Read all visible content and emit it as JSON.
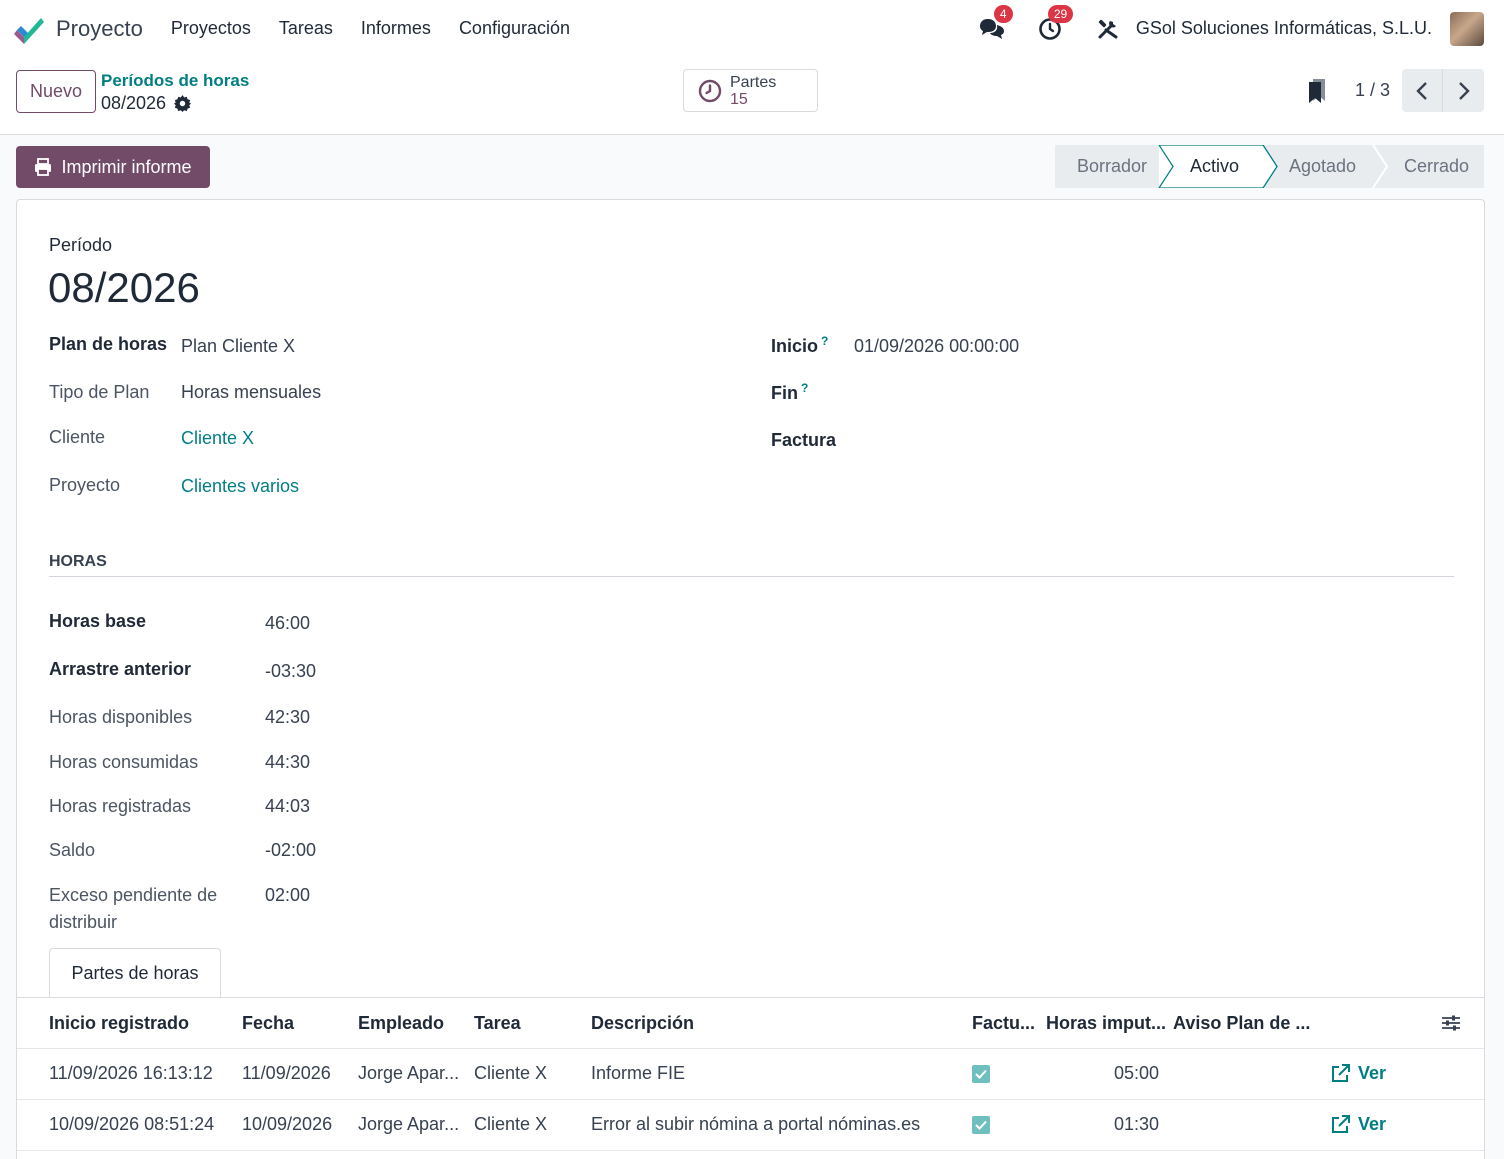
{
  "navbar": {
    "app_name": "Proyecto",
    "menu": [
      "Proyectos",
      "Tareas",
      "Informes",
      "Configuración"
    ],
    "messages_count": "4",
    "activities_count": "29",
    "company": "GSol Soluciones Informáticas, S.L.U."
  },
  "control": {
    "new_label": "Nuevo",
    "breadcrumb_parent": "Períodos de horas",
    "breadcrumb_current": "08/2026",
    "smart_label": "Partes",
    "smart_value": "15",
    "pager_value": "1 / 3"
  },
  "actions": {
    "print_label": "Imprimir informe",
    "stages": [
      "Borrador",
      "Activo",
      "Agotado",
      "Cerrado"
    ],
    "active_stage": "Activo"
  },
  "form": {
    "periodo_label": "Período",
    "title": "08/2026",
    "plan_label": "Plan de horas",
    "plan_value": "Plan Cliente X",
    "tipo_label": "Tipo de Plan",
    "tipo_value": "Horas mensuales",
    "cliente_label": "Cliente",
    "cliente_value": "Cliente X",
    "proyecto_label": "Proyecto",
    "proyecto_value": "Clientes varios",
    "inicio_label": "Inicio",
    "inicio_value": "01/09/2026 00:00:00",
    "fin_label": "Fin",
    "factura_label": "Factura",
    "help_mark": "?"
  },
  "horas": {
    "section_title": "HORAS",
    "base_label": "Horas base",
    "base_value": "46:00",
    "arrastre_label": "Arrastre anterior",
    "arrastre_value": "-03:30",
    "disponibles_label": "Horas disponibles",
    "disponibles_value": "42:30",
    "consumidas_label": "Horas consumidas",
    "consumidas_value": "44:30",
    "registradas_label": "Horas registradas",
    "registradas_value": "44:03",
    "saldo_label": "Saldo",
    "saldo_value": "-02:00",
    "exceso_label_1": "Exceso pendiente de",
    "exceso_label_2": "distribuir",
    "exceso_value": "02:00"
  },
  "tab": {
    "label": "Partes de horas"
  },
  "table": {
    "headers": [
      "Inicio registrado",
      "Fecha",
      "Empleado",
      "Tarea",
      "Descripción",
      "Factu...",
      "Horas imput...",
      "Aviso Plan de ..."
    ],
    "rows": [
      {
        "inicio": "11/09/2026 16:13:12",
        "fecha": "11/09/2026",
        "empleado": "Jorge Apar...",
        "tarea": "Cliente X",
        "descripcion": "Informe FIE",
        "facturable": true,
        "horas": "05:00",
        "action": "Ver"
      },
      {
        "inicio": "10/09/2026 08:51:24",
        "fecha": "10/09/2026",
        "empleado": "Jorge Apar...",
        "tarea": "Cliente X",
        "descripcion": "Error al subir nómina a portal nóminas.es",
        "facturable": true,
        "horas": "01:30",
        "action": "Ver"
      }
    ]
  },
  "colors": {
    "brand": "#714b67",
    "link": "#017e84",
    "badge": "#dc3545",
    "checkbox": "#6fbfbf"
  },
  "icons": [
    "app-logo-icon",
    "chat-icon",
    "clock-icon",
    "tools-icon",
    "gear-icon",
    "bookmark-icon",
    "chevron-left-icon",
    "chevron-right-icon",
    "printer-icon",
    "settings-sliders-icon",
    "external-link-icon",
    "check-icon"
  ]
}
